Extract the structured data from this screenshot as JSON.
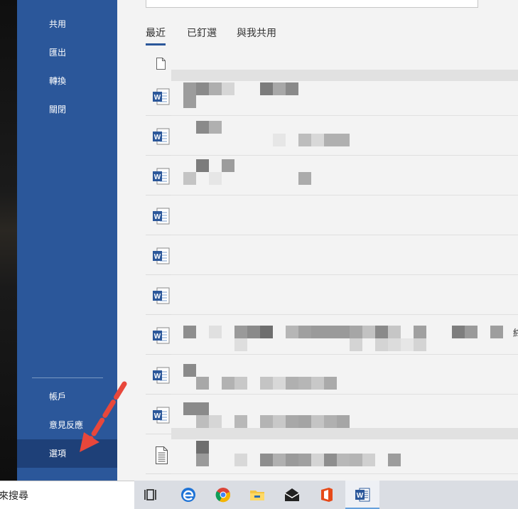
{
  "backstage": {
    "items": [
      {
        "label": "共用"
      },
      {
        "label": "匯出"
      },
      {
        "label": "轉換"
      },
      {
        "label": "關閉"
      }
    ],
    "bottom_items": [
      {
        "label": "帳戶"
      },
      {
        "label": "意見反應"
      },
      {
        "label": "選項"
      }
    ],
    "selected": "選項",
    "color": "#2b579a"
  },
  "tabs": [
    {
      "label": "最近",
      "active": true
    },
    {
      "label": "已釘選",
      "active": false
    },
    {
      "label": "與我共用",
      "active": false
    }
  ],
  "documents": [
    {
      "type": "word-icon"
    },
    {
      "type": "word-icon"
    },
    {
      "type": "word-icon"
    },
    {
      "type": "word-icon"
    },
    {
      "type": "word-icon"
    },
    {
      "type": "word-icon"
    },
    {
      "type": "word-icon"
    },
    {
      "type": "word-icon"
    },
    {
      "type": "word-icon"
    },
    {
      "type": "text-file-icon"
    }
  ],
  "edge_text": "終",
  "taskbar": {
    "search_text": "來搜尋",
    "apps": [
      "task-view-icon",
      "edge-icon",
      "chrome-icon",
      "file-explorer-icon",
      "mail-icon",
      "office-icon",
      "word-icon"
    ],
    "active_app": "word-icon"
  },
  "annotation": {
    "color": "#e8473b"
  }
}
